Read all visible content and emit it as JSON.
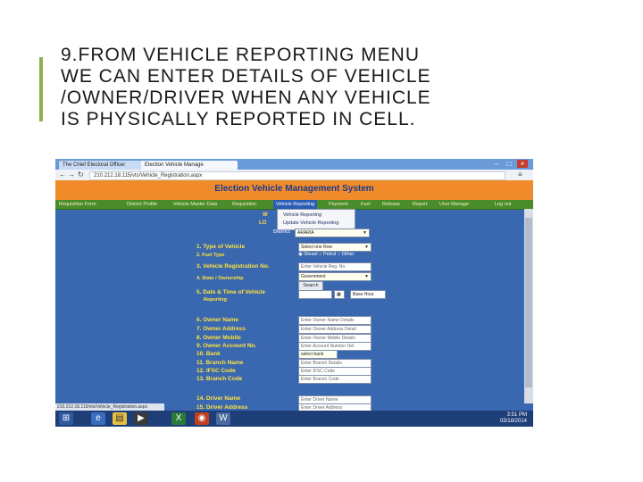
{
  "slide": {
    "title_lines": [
      "9.FROM  VEHICLE REPORTING MENU",
      "WE CAN ENTER DETAILS OF VEHICLE",
      "/OWNER/DRIVER WHEN ANY VEHICLE",
      "IS PHYSICALLY REPORTED IN CELL."
    ],
    "accent_color": "#8ab34a"
  },
  "browser": {
    "tabs": [
      "The Chief Electoral Officer",
      "Election Vehicle Manage"
    ],
    "url": "210.212.18.115/vts/Vehicle_Registration.aspx",
    "status_url": "210.212.18.115/vts/Vehicle_Registration.aspx"
  },
  "app": {
    "banner_title": "Election Vehicle Management System",
    "banner_color": "#f08a2a",
    "menu": [
      "Requisition Form",
      "District Profile",
      "Vehicle Master Data",
      "Requisition",
      "Vehicle Reporting",
      "Payment",
      "Fuel",
      "Release",
      "Report",
      "User Manage",
      "Log out"
    ],
    "submenu": [
      "Vehicle Reporting",
      "Update Vehicle Reporting"
    ],
    "left_snippets": [
      "W",
      "LO"
    ],
    "district_label": "District",
    "district_value": "ARARIA",
    "form": {
      "type_of_vehicle": {
        "label": "1. Type of Vehicle",
        "value": "Select one Row"
      },
      "fuel_type": {
        "label": "2. Fuel Type",
        "options": [
          "Diesel",
          "Petrol",
          "Other"
        ]
      },
      "registration_no": {
        "label": "3. Vehicle Registration No.",
        "placeholder": "Enter Vehicle Reg. No."
      },
      "ownership": {
        "label": "4. State / Ownership",
        "value": "Government"
      },
      "search_label": "Search",
      "datetime": {
        "label_1": "5. Date & Time of Vehicle",
        "label_2": "Reporting",
        "select": "Base Hour"
      },
      "owner_name": {
        "label": "6. Owner Name",
        "placeholder": "Enter Owner Name Details"
      },
      "owner_address": {
        "label": "7. Owner Address",
        "placeholder": "Enter Owner Address Detail"
      },
      "owner_mobile": {
        "label": "8. Owner Mobile",
        "placeholder": "Enter Owner Mobile Details"
      },
      "owner_account": {
        "label": "9. Owner Account No.",
        "placeholder": "Enter Account Number Det"
      },
      "bank": {
        "label": "10. Bank",
        "value": "select bank"
      },
      "branch_name": {
        "label": "11. Branch Name",
        "placeholder": "Enter Branch Details"
      },
      "ifsc": {
        "label": "12. IFSC Code",
        "placeholder": "Enter IFSC Code"
      },
      "branch_code": {
        "label": "13. Branch Code",
        "placeholder": "Enter Branch Code"
      },
      "driver_name": {
        "label": "14. Driver Name",
        "placeholder": "Enter Driver Name"
      },
      "driver_address": {
        "label": "15. Driver Address",
        "placeholder": "Enter Driver Address"
      }
    }
  },
  "taskbar": {
    "time": "3:51 PM",
    "date": "03/18/2014"
  }
}
